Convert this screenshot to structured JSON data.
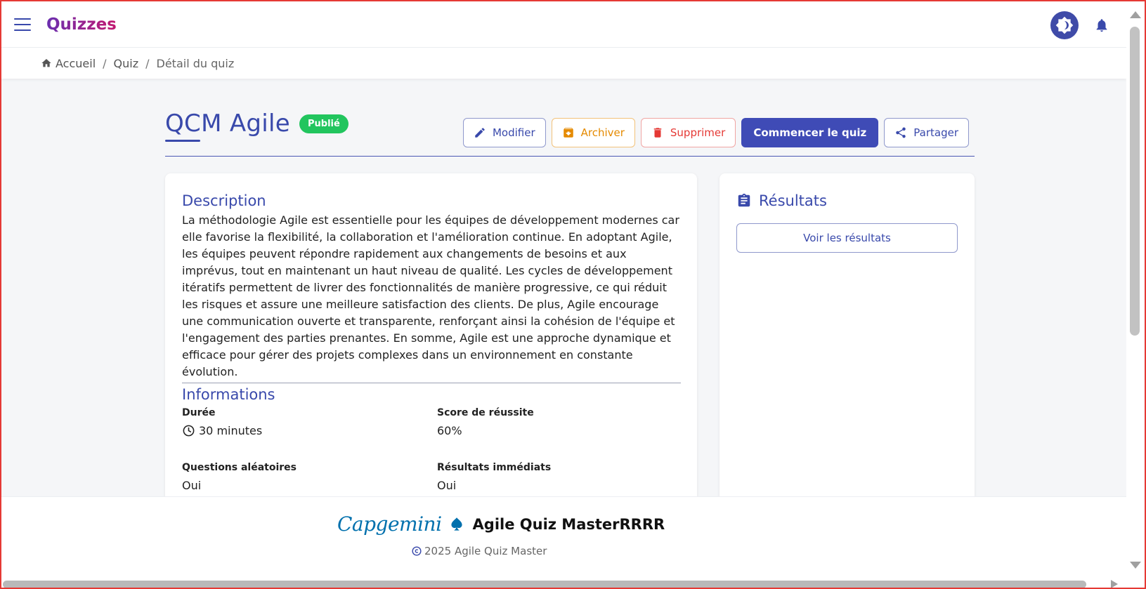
{
  "header": {
    "app_title": "Quizzes",
    "icons": {
      "menu": "menu-icon",
      "theme": "theme-toggle-icon",
      "notifications": "bell-icon"
    }
  },
  "breadcrumb": {
    "items": [
      "Accueil",
      "Quiz",
      "Détail du quiz"
    ],
    "separator": "/"
  },
  "quiz": {
    "title": "QCM Agile",
    "status": "Publié"
  },
  "actions": {
    "edit": "Modifier",
    "archive": "Archiver",
    "delete": "Supprimer",
    "start": "Commencer le quiz",
    "share": "Partager"
  },
  "description": {
    "heading": "Description",
    "text": "La méthodologie Agile est essentielle pour les équipes de développement modernes car elle favorise la flexibilité, la collaboration et l'amélioration continue. En adoptant Agile, les équipes peuvent répondre rapidement aux changements de besoins et aux imprévus, tout en maintenant un haut niveau de qualité. Les cycles de développement itératifs permettent de livrer des fonctionnalités de manière progressive, ce qui réduit les risques et assure une meilleure satisfaction des clients. De plus, Agile encourage une communication ouverte et transparente, renforçant ainsi la cohésion de l'équipe et l'engagement des parties prenantes. En somme, Agile est une approche dynamique et efficace pour gérer des projets complexes dans un environnement en constante évolution."
  },
  "informations": {
    "heading": "Informations",
    "duration_label": "Durée",
    "duration_value": "30 minutes",
    "score_label": "Score de réussite",
    "score_value": "60%",
    "random_label": "Questions aléatoires",
    "random_value": "Oui",
    "immediate_label": "Résultats immédiats",
    "immediate_value": "Oui"
  },
  "results": {
    "heading": "Résultats",
    "button": "Voir les résultats"
  },
  "footer": {
    "logo_text": "Capgemini",
    "app_name": "Agile Quiz MasterRRRR",
    "copyright": "2025 Agile Quiz Master"
  },
  "colors": {
    "primary": "#3949ab",
    "published": "#22c55e",
    "archive": "#e58a00",
    "delete": "#e53935",
    "capgemini": "#0070ad"
  }
}
